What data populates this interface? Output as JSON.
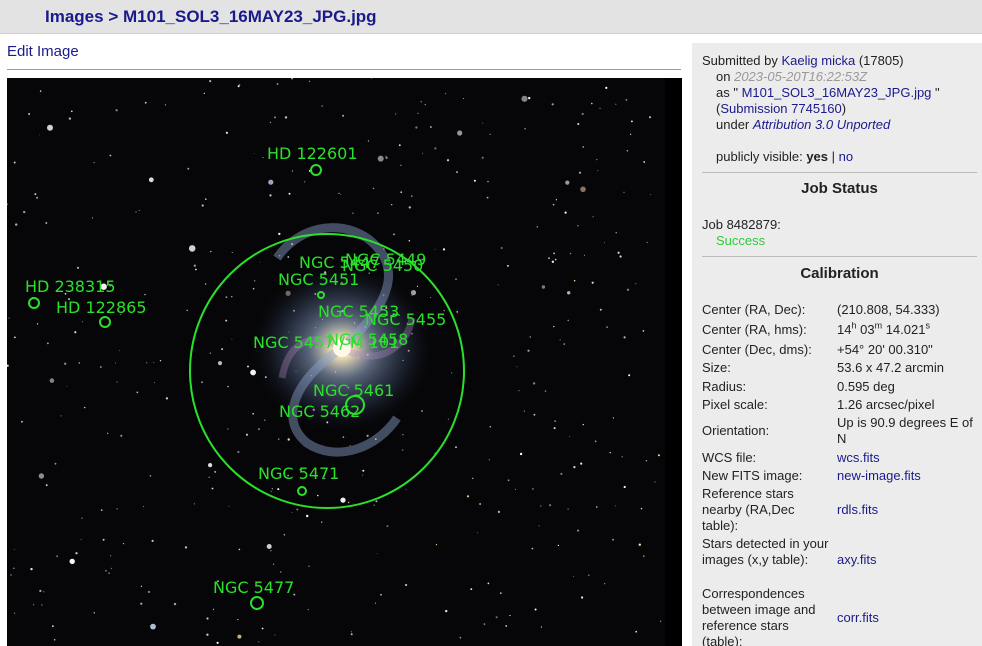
{
  "header": {
    "breadcrumb_root": "Images",
    "breadcrumb_sep": ">",
    "breadcrumb_file": "M101_SOL3_16MAY23_JPG.jpg"
  },
  "edit_link": "Edit Image",
  "image": {
    "alt": "Annotated astrometry image of M101 (Pinwheel Galaxy) with labeled objects",
    "labels": [
      "HD 122601",
      "HD 238315",
      "HD 122865",
      "NGC 5447",
      "NGC 5449",
      "NGC 5450",
      "NGC 5451",
      "NGC 5453",
      "NGC 5455",
      "NGC 5457 / M 101",
      "NGC 5458",
      "NGC 5461",
      "NGC 5462",
      "NGC 5471",
      "NGC 5477"
    ],
    "label_color": "#2be02b"
  },
  "submission": {
    "submitted_by_label": "Submitted by",
    "user": "Kaelig micka",
    "user_id": "(17805)",
    "on_label": "on",
    "date": "2023-05-20T16:22:53Z",
    "as_label": "as \"",
    "filename": "M101_SOL3_16MAY23_JPG.jpg",
    "as_close": "\"",
    "submission_open": "(",
    "submission_link": "Submission 7745160",
    "submission_close": ")",
    "under_label": "under",
    "license": "Attribution 3.0 Unported",
    "visible_label": "publicly visible:",
    "visible_yes": "yes",
    "visible_sep": "|",
    "visible_no": "no"
  },
  "job_status": {
    "title": "Job Status",
    "job_label": "Job 8482879:",
    "status": "Success"
  },
  "calibration": {
    "title": "Calibration",
    "center_radec_label": "Center (RA, Dec):",
    "center_radec_value": "(210.808, 54.333)",
    "center_hms_label": "Center (RA, hms):",
    "hms_h": "14",
    "hms_h_unit": "h",
    "hms_m": "03",
    "hms_m_unit": "m",
    "hms_s": "14.021",
    "hms_s_unit": "s",
    "center_dms_label": "Center (Dec, dms):",
    "center_dms_value": "+54° 20' 00.310\"",
    "size_label": "Size:",
    "size_value": "53.6 x 47.2 arcmin",
    "radius_label": "Radius:",
    "radius_value": "0.595 deg",
    "pixel_scale_label": "Pixel scale:",
    "pixel_scale_value": "1.26 arcsec/pixel",
    "orientation_label": "Orientation:",
    "orientation_value": "Up is 90.9 degrees E of N",
    "wcs_label": "WCS file:",
    "wcs_value": "wcs.fits",
    "newfits_label": "New FITS image:",
    "newfits_value": "new-image.fits",
    "refstars_label": "Reference stars nearby (RA,Dec table):",
    "refstars_value": "rdls.fits",
    "stars_label": "Stars detected in your images (x,y table):",
    "stars_value": "axy.fits",
    "corr_label": "Correspondences between image and reference stars (table):",
    "corr_value": "corr.fits"
  }
}
